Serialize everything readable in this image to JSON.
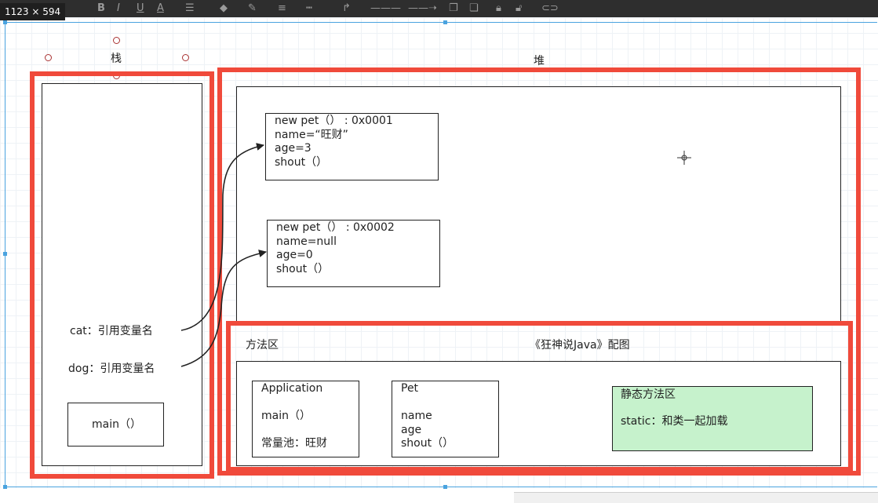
{
  "dimension_badge": "1123 × 594",
  "toolbar": {
    "icons": [
      "bold-icon",
      "italic-icon",
      "underline-icon",
      "font-color-icon",
      "align-icon",
      "fill-color-icon",
      "line-color-icon",
      "line-width-icon",
      "line-style-icon",
      "connector-icon",
      "line-icon",
      "arrow-style-icon",
      "group-icon",
      "ungroup-icon",
      "lock-icon",
      "unlock-icon",
      "link-icon"
    ],
    "labels": {
      "bold": "B",
      "italic": "I",
      "underline": "U",
      "font_color": "A"
    }
  },
  "stack": {
    "title": "栈",
    "items": [
      {
        "label": "cat：引用变量名"
      },
      {
        "label": "dog：引用变量名"
      }
    ],
    "main_frame": "main（）"
  },
  "heap": {
    "title": "堆",
    "objects": [
      {
        "lines": [
          "new pet（）   :   0x0001",
          "name=“旺财”",
          "age=3",
          "shout（）"
        ]
      },
      {
        "lines": [
          "new pet（）   :   0x0002",
          "name=null",
          "age=0",
          "shout（）"
        ]
      }
    ]
  },
  "method_area": {
    "title": "方法区",
    "caption": "《狂神说Java》配图",
    "classes": [
      {
        "lines": [
          "Application",
          "",
          "main（）",
          "",
          "常量池：旺财"
        ]
      },
      {
        "lines": [
          "Pet",
          "",
          "name",
          "age",
          "shout（）"
        ]
      }
    ],
    "static_area": {
      "title": "静态方法区",
      "text": "static：和类一起加载",
      "color": "#c6f2cc"
    }
  },
  "colors": {
    "highlight_red": "#f04a3b",
    "selection_blue": "#4aa3df"
  }
}
